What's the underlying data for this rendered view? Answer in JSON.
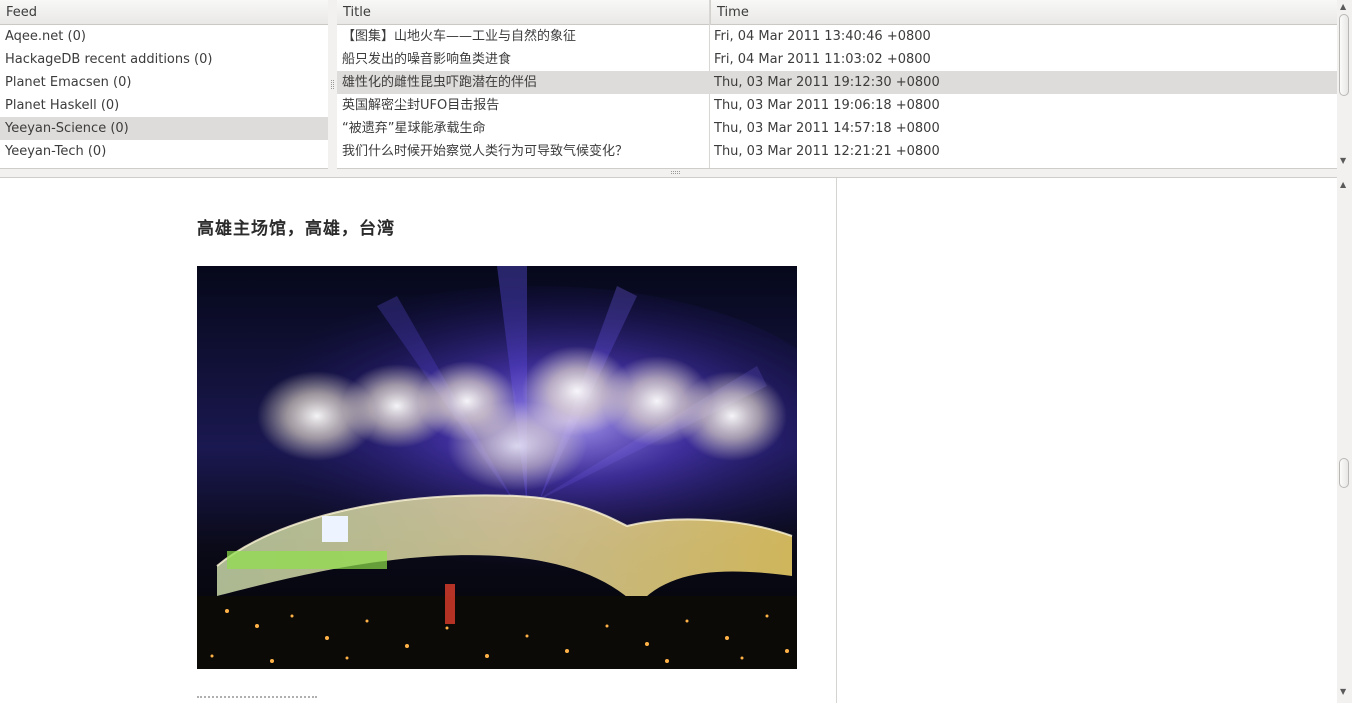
{
  "feeds": {
    "header": "Feed",
    "items": [
      {
        "label": "Aqee.net (0)",
        "selected": false
      },
      {
        "label": "HackageDB recent additions (0)",
        "selected": false
      },
      {
        "label": "Planet Emacsen (0)",
        "selected": false
      },
      {
        "label": "Planet Haskell (0)",
        "selected": false
      },
      {
        "label": "Yeeyan-Science (0)",
        "selected": true
      },
      {
        "label": "Yeeyan-Tech (0)",
        "selected": false
      }
    ]
  },
  "articles": {
    "title_header": "Title",
    "time_header": "Time",
    "rows": [
      {
        "title": "【图集】山地火车——工业与自然的象征",
        "time": "Fri, 04 Mar 2011 13:40:46 +0800",
        "selected": false
      },
      {
        "title": "船只发出的噪音影响鱼类进食",
        "time": "Fri, 04 Mar 2011 11:03:02 +0800",
        "selected": false
      },
      {
        "title": "雄性化的雌性昆虫吓跑潜在的伴侣",
        "time": "Thu, 03 Mar 2011 19:12:30 +0800",
        "selected": true
      },
      {
        "title": "英国解密尘封UFO目击报告",
        "time": "Thu, 03 Mar 2011 19:06:18 +0800",
        "selected": false
      },
      {
        "title": "“被遗弃”星球能承载生命",
        "time": "Thu, 03 Mar 2011 14:57:18 +0800",
        "selected": false
      },
      {
        "title": "我们什么时候开始察觉人类行为可导致气候变化？",
        "time": "Thu, 03 Mar 2011 12:21:21 +0800",
        "selected": false
      }
    ]
  },
  "content": {
    "heading": "高雄主场馆，高雄，台湾",
    "image_icon": "stadium-fireworks-photo"
  },
  "scroll": {
    "article_list_position": 0.0,
    "content_position": 0.55
  },
  "icons": {
    "scroll_up": "scroll-up-arrow-icon",
    "scroll_down": "scroll-down-arrow-icon"
  }
}
